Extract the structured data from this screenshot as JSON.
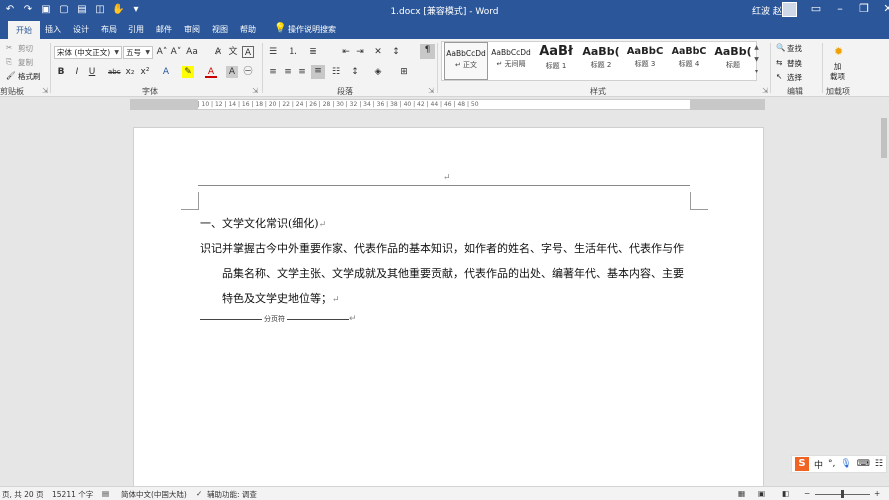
{
  "titlebar": {
    "title": "1.docx [兼容模式] - Word",
    "user": "红波 赵",
    "qat_icons": [
      "undo-icon",
      "redo-icon",
      "save-icon",
      "new-doc-icon",
      "open-icon",
      "print-preview-icon",
      "touch-mode-icon"
    ]
  },
  "tabs": [
    "开始",
    "插入",
    "设计",
    "布局",
    "引用",
    "邮件",
    "审阅",
    "视图",
    "帮助"
  ],
  "tell_me": "操作说明搜索",
  "clipboard": {
    "cut": "剪切",
    "copy": "复制",
    "format_painter": "格式刷",
    "label": "剪贴板"
  },
  "font": {
    "name": "宋体 (中文正文)",
    "size": "五号",
    "label": "字体"
  },
  "paragraph": {
    "label": "段落"
  },
  "styles": {
    "label": "样式",
    "items": [
      {
        "preview": "AaBbCcDd",
        "name": "↵ 正文"
      },
      {
        "preview": "AaBbCcDd",
        "name": "↵ 无间隔"
      },
      {
        "preview": "AaBł",
        "name": "标题 1"
      },
      {
        "preview": "AaBb(",
        "name": "标题 2"
      },
      {
        "preview": "AaBbC",
        "name": "标题 3"
      },
      {
        "preview": "AaBbC",
        "name": "标题 4"
      },
      {
        "preview": "AaBb(",
        "name": "标题"
      }
    ]
  },
  "editing": {
    "find": "查找",
    "replace": "替换",
    "select": "选择",
    "label": "编辑"
  },
  "addins": {
    "button": "加\n载项",
    "label": "加载项"
  },
  "ruler": "6 | 4 | 2 |   | 2 | 4 | 6 | 8 | 10 | 12 | 14 | 16 | 18 | 20 | 22 | 24 | 26 | 28 | 30 | 32 | 34 | 36 | 38 | 40 | 42 | 44 | 46 | 48 | 50",
  "document": {
    "header_mark": "↵",
    "heading": "一、文学文化常识(细化)",
    "para_line1": "识记并掌握古今中外重要作家、代表作品的基本知识，如作者的姓名、字号、生活年代、代表作与作",
    "para_line2": "品集名称、文学主张、文学成就及其他重要贡献，代表作品的出处、编著年代、基本内容、主要",
    "para_line3": "特色及文学史地位等；",
    "para_mark": "↵",
    "page_break": "分页符"
  },
  "ime": {
    "logo": "S",
    "mode": "中"
  },
  "statusbar": {
    "page": "页, 共 20 页",
    "words": "15211 个字",
    "language": "简体中文(中国大陆)",
    "accessibility": "辅助功能: 调查"
  }
}
